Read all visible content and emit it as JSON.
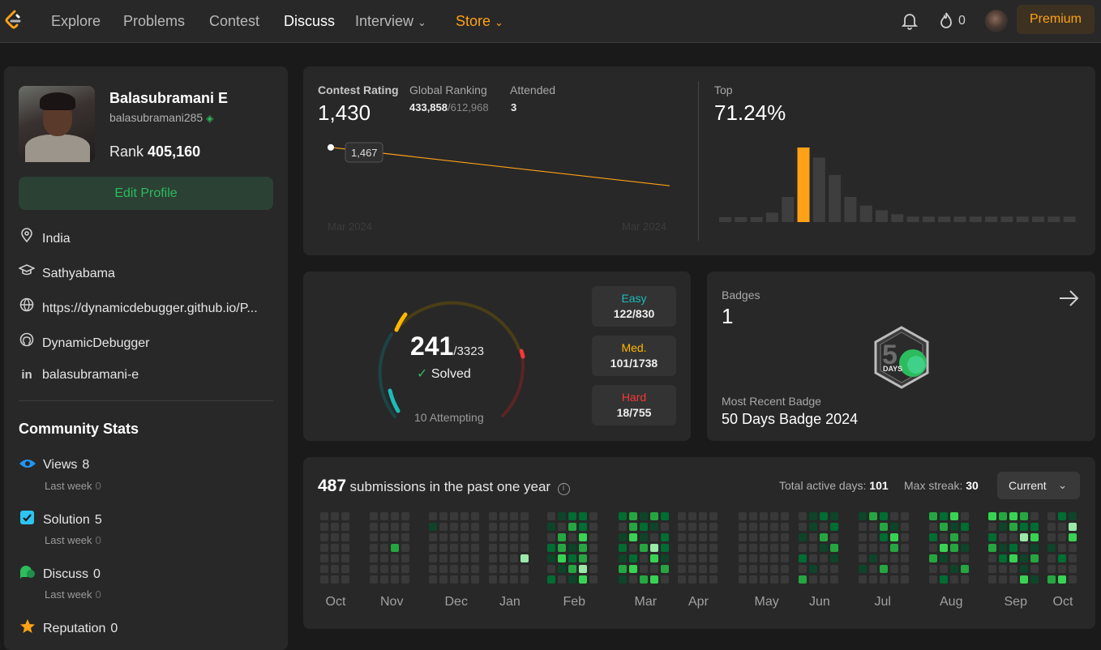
{
  "nav": {
    "items": [
      "Explore",
      "Problems",
      "Contest",
      "Discuss",
      "Interview",
      "Store"
    ],
    "streak": "0",
    "premium": "Premium"
  },
  "profile": {
    "name": "Balasubramani E",
    "username": "balasubramani285",
    "rank_label": "Rank",
    "rank": "405,160",
    "edit": "Edit Profile",
    "location": "India",
    "school": "Sathyabama",
    "website": "https://dynamicdebugger.github.io/P...",
    "github": "DynamicDebugger",
    "linkedin": "balasubramani-e"
  },
  "community": {
    "title": "Community Stats",
    "stats": [
      {
        "label": "Views",
        "value": "8",
        "sub": "Last week",
        "subv": "0",
        "color": "#2196f3"
      },
      {
        "label": "Solution",
        "value": "5",
        "sub": "Last week",
        "subv": "0",
        "color": "#2ec4f1"
      },
      {
        "label": "Discuss",
        "value": "0",
        "sub": "Last week",
        "subv": "0",
        "color": "#2cbb5d"
      },
      {
        "label": "Reputation",
        "value": "0",
        "color": "#ffa116"
      }
    ]
  },
  "contest": {
    "rating_label": "Contest Rating",
    "rating": "1,430",
    "global_label": "Global Ranking",
    "global": "433,858",
    "global_total": "/612,968",
    "attended_label": "Attended",
    "attended": "3",
    "point_label": "1,467",
    "x_start": "Mar 2024",
    "x_end": "Mar 2024",
    "top_label": "Top",
    "top": "71.24%"
  },
  "chart_data": {
    "type": "line",
    "series": [
      {
        "values": [
          1467,
          1430
        ]
      }
    ],
    "x": [
      "Mar 2024",
      "Mar 2024"
    ],
    "annotations": [
      "1,467"
    ]
  },
  "histogram": {
    "levels": [
      0.06,
      0.06,
      0.06,
      0.12,
      0.32,
      1.0,
      0.82,
      0.6,
      0.32,
      0.21,
      0.15,
      0.1,
      0.07,
      0.07,
      0.07,
      0.07,
      0.07,
      0.07,
      0.07,
      0.07,
      0.07,
      0.07,
      0.07
    ],
    "highlight": 5,
    "color_hi": "#ffa116",
    "color": "#3e3e3e"
  },
  "solved": {
    "count": "241",
    "total": "/3323",
    "label": "Solved",
    "attempting": "10 Attempting",
    "easy_label": "Easy",
    "easy": "122/830",
    "med_label": "Med.",
    "med": "101/1738",
    "hard_label": "Hard",
    "hard": "18/755",
    "colors": {
      "easy": "#1cbaba",
      "med": "#ffb700",
      "hard": "#f63737"
    }
  },
  "badges": {
    "label": "Badges",
    "count": "1",
    "recent_label": "Most Recent Badge",
    "recent": "50 Days Badge 2024",
    "badge_days": "DAYS"
  },
  "heatmap": {
    "count": "487",
    "text": "submissions in the past one year",
    "active_label": "Total active days:",
    "active": "101",
    "streak_label": "Max streak:",
    "streak": "30",
    "dropdown": "Current",
    "months": [
      "Oct",
      "Nov",
      "Dec",
      "Jan",
      "Feb",
      "Mar",
      "Apr",
      "May",
      "Jun",
      "Jul",
      "Aug",
      "Sep",
      "Oct"
    ]
  }
}
